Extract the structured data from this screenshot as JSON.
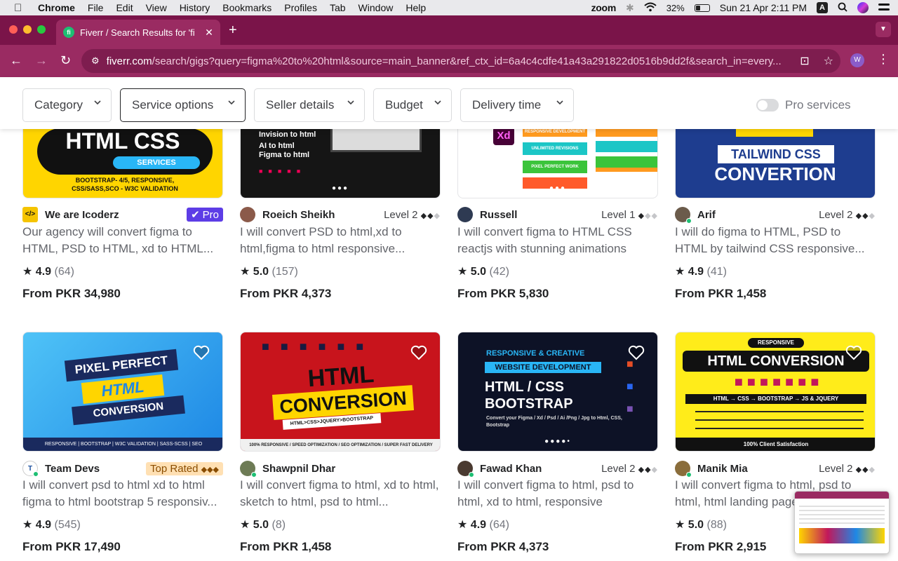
{
  "menubar": {
    "app": "Chrome",
    "items": [
      "File",
      "Edit",
      "View",
      "History",
      "Bookmarks",
      "Profiles",
      "Tab",
      "Window",
      "Help"
    ],
    "zoom": "zoom",
    "battery": "32%",
    "battery_level": 0.32,
    "datetime": "Sun 21 Apr  2:11 PM",
    "input_source": "A"
  },
  "browser": {
    "tab_title": "Fiverr / Search Results for 'fi",
    "favicon": "fi",
    "url_host": "fiverr.com",
    "url_path": "/search/gigs?query=figma%20to%20html&source=main_banner&ref_ctx_id=6a4c4cdfe41a43a291822d0516b9dd2f&search_in=every...",
    "profile_initial": "W"
  },
  "filters": {
    "category": "Category",
    "service_options": "Service options",
    "seller_details": "Seller details",
    "budget": "Budget",
    "delivery_time": "Delivery time",
    "pro_services": "Pro services"
  },
  "gigs": [
    {
      "thumb_text": "HTML CSS",
      "thumb_sub": "SERVICES",
      "thumb_caption": "BOOTSTRAP- 4/5, RESPONSIVE, CSS/SASS,SCO - W3C VALIDATION",
      "seller": "We are Icoderz",
      "badge": "Pro",
      "title": "Our agency will convert figma to HTML, PSD to HTML, xd to HTML...",
      "rating": "4.9",
      "count": "(64)",
      "price": "From PKR 34,980"
    },
    {
      "thumb_text": "Invision to html",
      "thumb_sub": "AI to html",
      "thumb_caption": "Figma to html",
      "seller": "Roeich Sheikh",
      "level": "Level 2",
      "title": "I will convert PSD to html,xd to html,figma to html responsive...",
      "rating": "5.0",
      "count": "(157)",
      "price": "From PKR 4,373"
    },
    {
      "thumb_text": "RESPONSIVE DEVELOPMENT",
      "thumb_sub": "UNLIMITED REVISIONS",
      "thumb_caption": "PIXEL PERFECT WORK",
      "seller": "Russell",
      "level": "Level 1",
      "title": "I will convert figma to HTML CSS reactjs with stunning animations",
      "rating": "5.0",
      "count": "(42)",
      "price": "From PKR 5,830"
    },
    {
      "thumb_text": "TAILWIND CSS",
      "thumb_sub": "CONVERTION",
      "thumb_caption": "",
      "seller": "Arif",
      "level": "Level 2",
      "title": "I will do figma to HTML, PSD to HTML by tailwind CSS responsive...",
      "rating": "4.9",
      "count": "(41)",
      "price": "From PKR 1,458"
    },
    {
      "thumb_text": "PIXEL PERFECT",
      "thumb_sub": "HTML",
      "thumb_caption": "CONVERSION",
      "thumb_footer": "RESPONSIVE | BOOTSTRAP | W3C VALIDATION | SASS-SCSS | SEO",
      "seller": "Team Devs",
      "badge": "Top Rated",
      "title": "I will convert psd to html xd to html figma to html bootstrap 5 responsiv...",
      "rating": "4.9",
      "count": "(545)",
      "price": "From PKR 17,490"
    },
    {
      "thumb_text": "HTML",
      "thumb_sub": "CONVERSION",
      "thumb_caption": "HTML>CSS>JQUERY>BOOTSTRAP",
      "thumb_footer": "100% RESPONSIVE / SPEED OPTIMIZATION / SEO OPTIMIZATION / SUPER FAST DELIVERY",
      "seller": "Shawpnil Dhar",
      "level": "",
      "title": "I will convert figma to html, xd to html, sketch to html, psd to html...",
      "rating": "5.0",
      "count": "(8)",
      "price": "From PKR 1,458"
    },
    {
      "thumb_text": "RESPONSIVE & CREATIVE",
      "thumb_sub": "WEBSITE DEVELOPMENT",
      "thumb_caption": "HTML / CSS BOOTSTRAP",
      "thumb_footer": "Convert your Figma / Xd / Psd / Ai /Png / Jpg to Html, CSS, Bootstrap",
      "seller": "Fawad Khan",
      "level": "Level 2",
      "title": "I will convert figma to html, psd to html, xd to html, responsive",
      "rating": "4.9",
      "count": "(64)",
      "price": "From PKR 4,373"
    },
    {
      "thumb_text": "RESPONSIVE",
      "thumb_sub": "HTML CONVERSION",
      "thumb_caption": "HTML → CSS → BOOTSTRAP → JS & JQUERY",
      "thumb_footer": "100% Client Satisfaction",
      "seller": "Manik Mia",
      "level": "Level 2",
      "title": "I will convert figma to html, psd to html, html landing page",
      "rating": "5.0",
      "count": "(88)",
      "price": "From PKR 2,915"
    }
  ]
}
